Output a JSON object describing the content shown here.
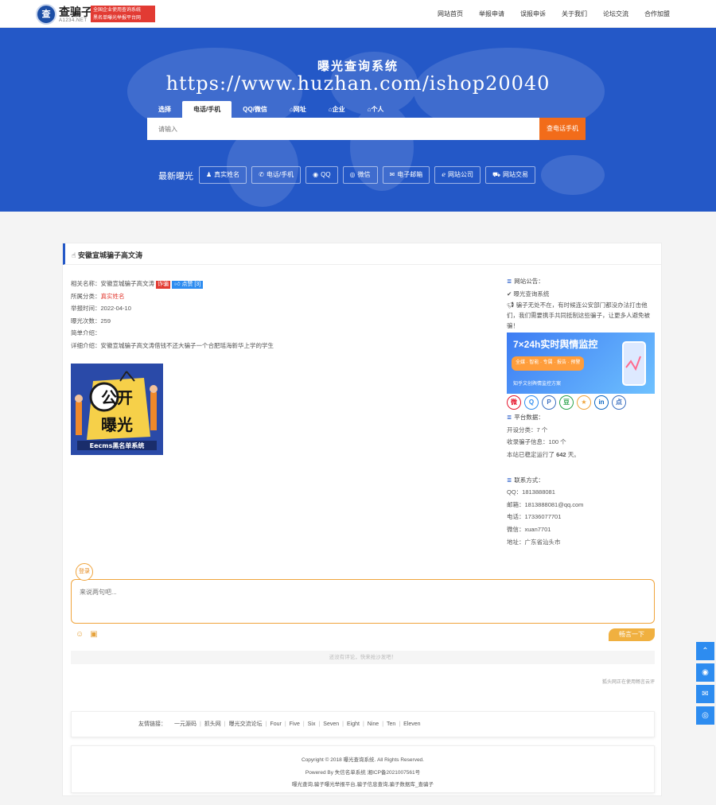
{
  "header": {
    "logo_mark": "查",
    "site_name": "查骗子",
    "site_domain": "A1234.NET",
    "slogan_line1": "全国企业使用查询系统",
    "slogan_line2": "黑名单曝光举报平台网",
    "nav": [
      "网站首页",
      "举报申请",
      "误报申诉",
      "关于我们",
      "论坛交流",
      "合作加盟"
    ]
  },
  "hero": {
    "title": "曝光查询系统",
    "url": "https://www.huzhan.com/ishop20040",
    "tabs": [
      "选择",
      "电话/手机",
      "QQ/微信",
      "网址",
      "企业",
      "个人"
    ],
    "active_tab": "电话/手机",
    "search_placeholder": "请输入",
    "search_button": "查电话手机",
    "latest_label": "最新曝光",
    "latest_buttons": [
      {
        "icon": "person-icon",
        "glyph": "♟",
        "label": "真实姓名"
      },
      {
        "icon": "whatsapp-icon",
        "glyph": "✆",
        "label": "电话/手机"
      },
      {
        "icon": "qq-icon",
        "glyph": "◉",
        "label": "QQ"
      },
      {
        "icon": "wechat-icon",
        "glyph": "◎",
        "label": "微信"
      },
      {
        "icon": "mail-icon",
        "glyph": "✉",
        "label": "电子邮箱"
      },
      {
        "icon": "ie-icon",
        "glyph": "ℯ",
        "label": "网站公司"
      },
      {
        "icon": "cart-icon",
        "glyph": "⛟",
        "label": "网站交易"
      }
    ]
  },
  "detail": {
    "panel_title": "安徽宣城骗子高文涛",
    "name_label": "相关名称：",
    "name_value": "安徽宣城骗子高文涛",
    "fraud_tag": "诈骗",
    "like_label": "点赞 [3]",
    "category_label": "所属分类：",
    "category_value": "真实姓名",
    "date_label": "举报时间：",
    "date_value": "2022-04-10",
    "count_label": "曝光次数：",
    "count_value": "259",
    "intro_label": "简单介绍：",
    "detail_label": "详细介绍：",
    "detail_value": "安徽宣城骗子高文涛借钱不还大骗子一个合肥瑶海新华上学的学生",
    "image_text_top": "公开",
    "image_text_mid": "曝光",
    "image_caption": "Eecms黑名单系统"
  },
  "sidebar": {
    "notice_title": "网站公告：",
    "notice_system": "曝光查询系统",
    "notice_text": "骗子无处不在，有时候连公安部门都没办法打击他们，我们需要携手共同抵制这些骗子，让更多人避免被骗！",
    "ad_title": "7×24h实时舆情监控",
    "ad_tags": "全媒 · 智能 · 专属 · 报告 · 预警",
    "ad_footer": "知乎文创舆情监控方案",
    "share_icons": [
      {
        "name": "weibo-icon",
        "glyph": "微",
        "color": "#e6162d"
      },
      {
        "name": "qq-share-icon",
        "glyph": "Q",
        "color": "#2d8cf0"
      },
      {
        "name": "pinterest-icon",
        "glyph": "P",
        "color": "#3b6fc0"
      },
      {
        "name": "douban-icon",
        "glyph": "豆",
        "color": "#2aa34a"
      },
      {
        "name": "star-icon",
        "glyph": "★",
        "color": "#f0a43c"
      },
      {
        "name": "linkedin-icon",
        "glyph": "in",
        "color": "#0a66c2"
      },
      {
        "name": "dianping-icon",
        "glyph": "点",
        "color": "#3b6fc0"
      }
    ],
    "stats_title": "平台数据：",
    "stats_category": "开设分类：7 个",
    "stats_records": "收录骗子信息：100 个",
    "stats_days_prefix": "本站已稳定运行了 ",
    "stats_days": "642",
    "stats_days_suffix": " 天。",
    "contact_title": "联系方式：",
    "contact_qq": "QQ：1813888081",
    "contact_email": "邮箱：1813888081@qq.com",
    "contact_phone": "电话：17336077701",
    "contact_wechat": "微信：xuan7701",
    "contact_address": "地址：广东省汕头市"
  },
  "comments": {
    "login_label": "登录",
    "placeholder": "来说两句吧...",
    "send_label": "畅言一下",
    "empty_text": "还没有评论，快来抢沙发吧！",
    "powered": "狐头网正在使用畅言云评"
  },
  "footer": {
    "links_label": "友情链接：",
    "links": [
      "一元源码",
      "抓头网",
      "曝光交流论坛",
      "Four",
      "Five",
      "Six",
      "Seven",
      "Eight",
      "Nine",
      "Ten",
      "Eleven"
    ],
    "copyright": "Copyright © 2018 曝光查询系统. All Rights Reserved.",
    "powered": "Powered By 失信名单系统  湘ICP备2021007561号",
    "keywords": "曝光查询,骗子曝光举报平台,骗子信息查询,骗子数据库_查骗子"
  },
  "float_buttons": [
    {
      "name": "back-to-top-icon",
      "glyph": "⌃"
    },
    {
      "name": "qq-float-icon",
      "glyph": "◉"
    },
    {
      "name": "mail-float-icon",
      "glyph": "✉"
    },
    {
      "name": "wechat-float-icon",
      "glyph": "◎"
    }
  ],
  "colors": {
    "brand_blue": "#2458c7",
    "search_orange": "#f26c1a",
    "alert_red": "#e23b33",
    "comment_orange": "#f0a43c"
  }
}
